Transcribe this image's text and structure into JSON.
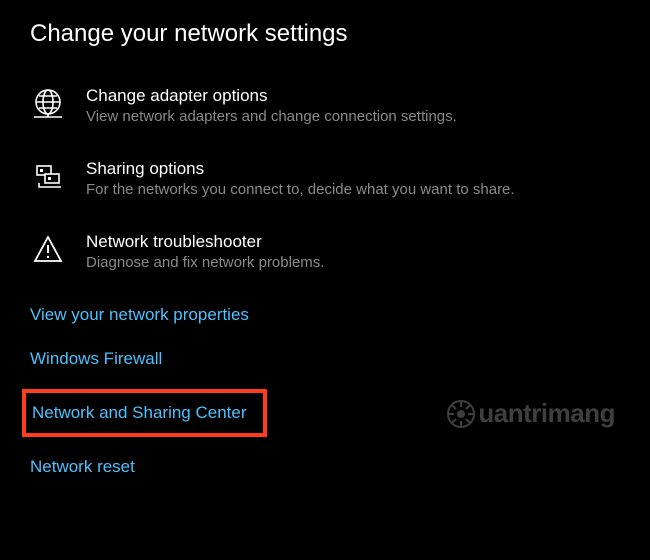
{
  "heading": "Change your network settings",
  "options": [
    {
      "title": "Change adapter options",
      "desc": "View network adapters and change connection settings."
    },
    {
      "title": "Sharing options",
      "desc": "For the networks you connect to, decide what you want to share."
    },
    {
      "title": "Network troubleshooter",
      "desc": "Diagnose and fix network problems."
    }
  ],
  "links": {
    "view_properties": "View your network properties",
    "firewall": "Windows Firewall",
    "sharing_center": "Network and Sharing Center",
    "reset": "Network reset"
  },
  "watermark": "uantrimang"
}
